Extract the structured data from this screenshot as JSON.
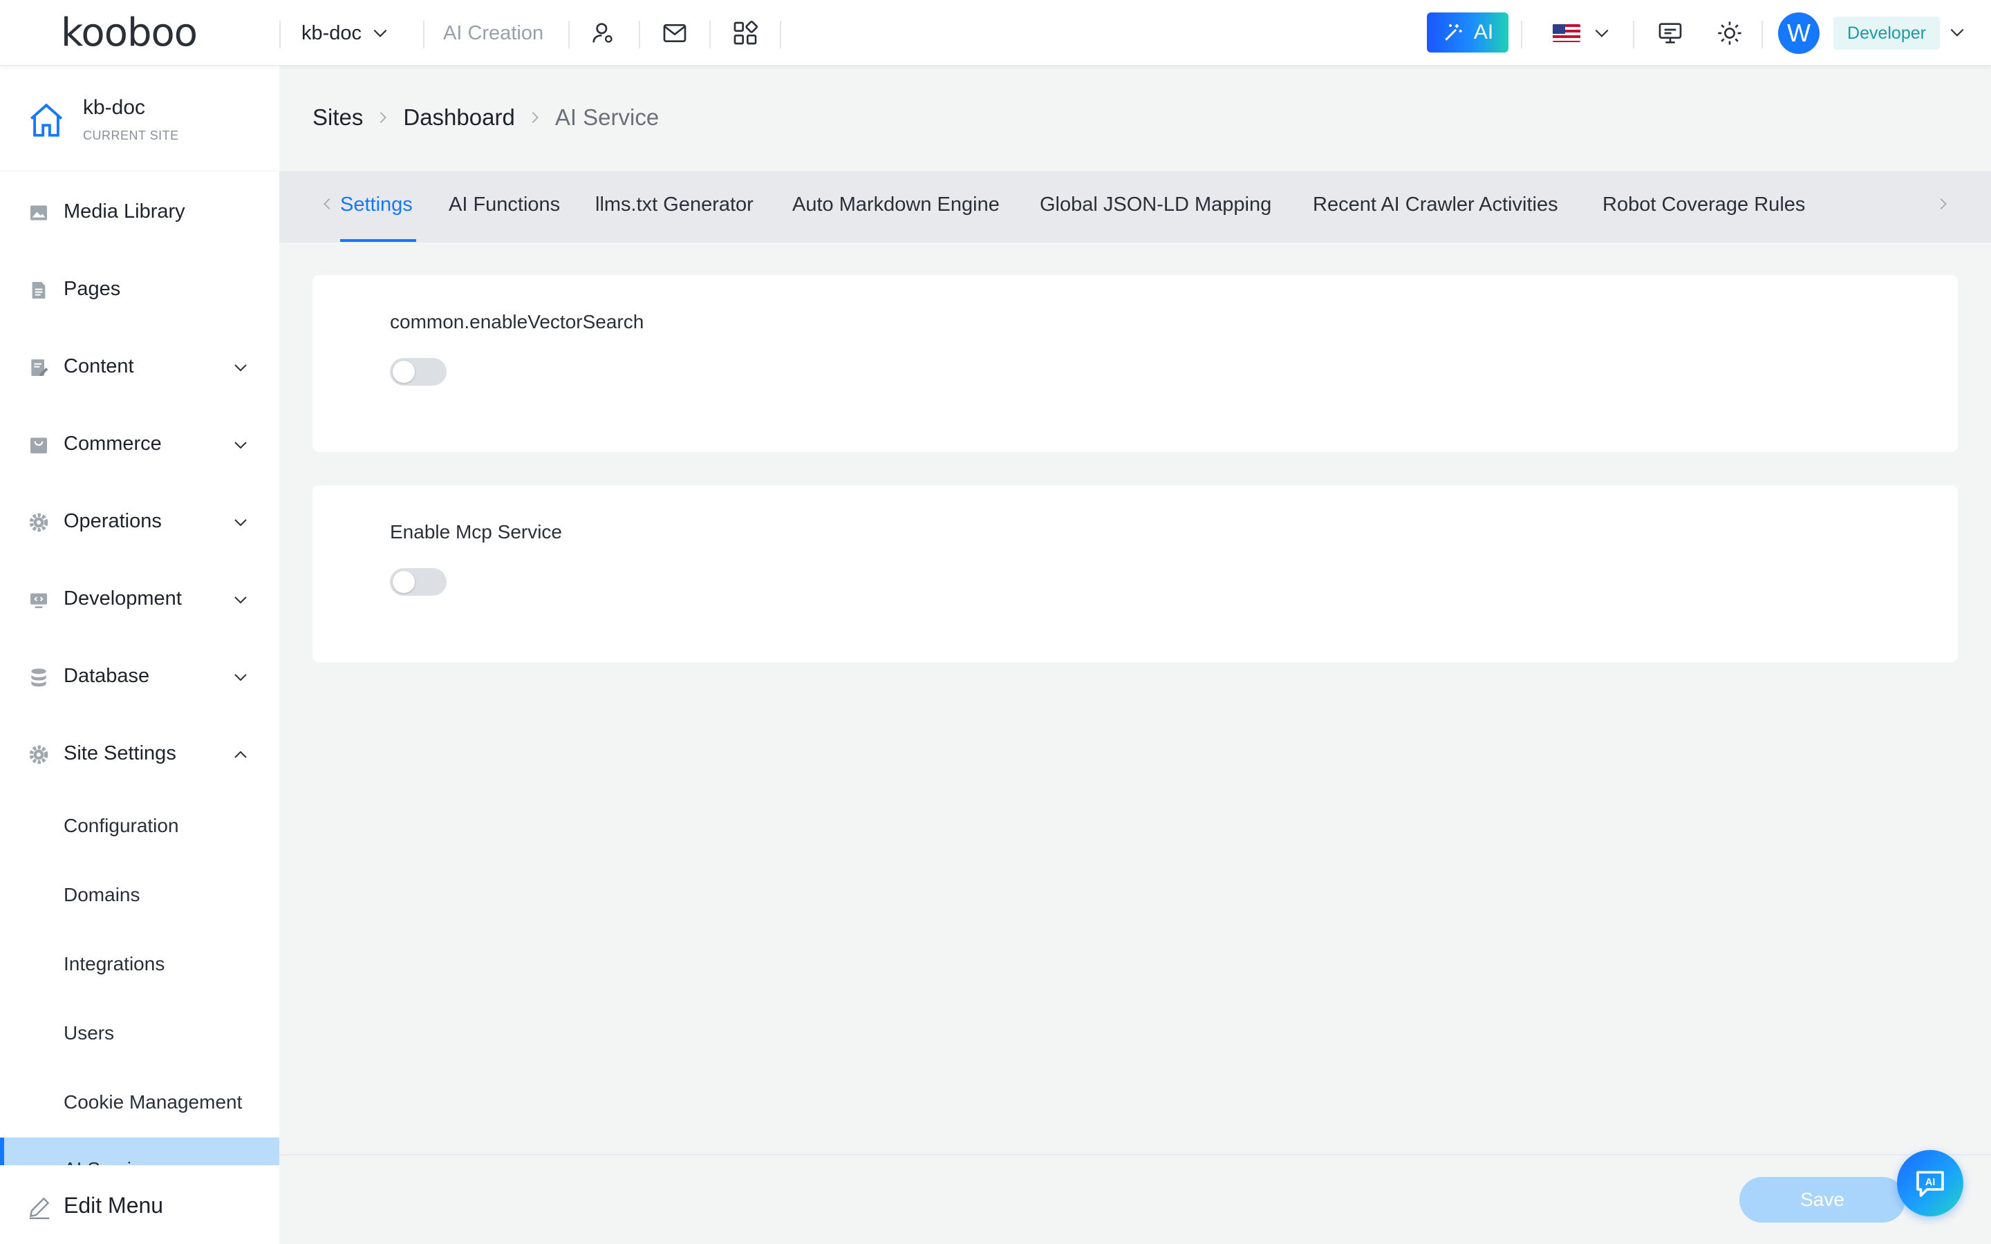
{
  "header": {
    "logo": "kooboo",
    "site_name": "kb-doc",
    "ai_creation": "AI Creation",
    "ai_button": "AI",
    "avatar_initial": "W",
    "role": "Developer",
    "brand_color": "#1677ff"
  },
  "sidebar": {
    "site_name": "kb-doc",
    "site_sub": "CURRENT SITE",
    "items": [
      {
        "label": "Media Library",
        "icon": "image-icon"
      },
      {
        "label": "Pages",
        "icon": "document-icon"
      },
      {
        "label": "Content",
        "icon": "edit-document-icon"
      },
      {
        "label": "Commerce",
        "icon": "shopping-bag-icon"
      },
      {
        "label": "Operations",
        "icon": "gear-icon"
      },
      {
        "label": "Development",
        "icon": "code-icon"
      },
      {
        "label": "Database",
        "icon": "database-icon"
      },
      {
        "label": "Site Settings",
        "icon": "gear-icon"
      }
    ],
    "sub_items": [
      "Configuration",
      "Domains",
      "Integrations",
      "Users",
      "Cookie Management"
    ],
    "active_sub": "AI Service",
    "edit_menu": "Edit Menu"
  },
  "breadcrumb": {
    "items": [
      "Sites",
      "Dashboard"
    ],
    "current": "AI Service"
  },
  "tabs": [
    {
      "label": "Settings",
      "active": true
    },
    {
      "label": "AI Functions",
      "active": false
    },
    {
      "label": "llms.txt Generator",
      "active": false
    },
    {
      "label": "Auto Markdown Engine",
      "active": false
    },
    {
      "label": "Global JSON-LD Mapping",
      "active": false
    },
    {
      "label": "Recent AI Crawler Activities",
      "active": false
    },
    {
      "label": "Robot Coverage Rules",
      "active": false
    }
  ],
  "settings": [
    {
      "label": "common.enableVectorSearch",
      "enabled": false
    },
    {
      "label": "Enable Mcp Service",
      "enabled": false
    }
  ],
  "footer": {
    "save": "Save",
    "ai_assistant": "AI"
  }
}
